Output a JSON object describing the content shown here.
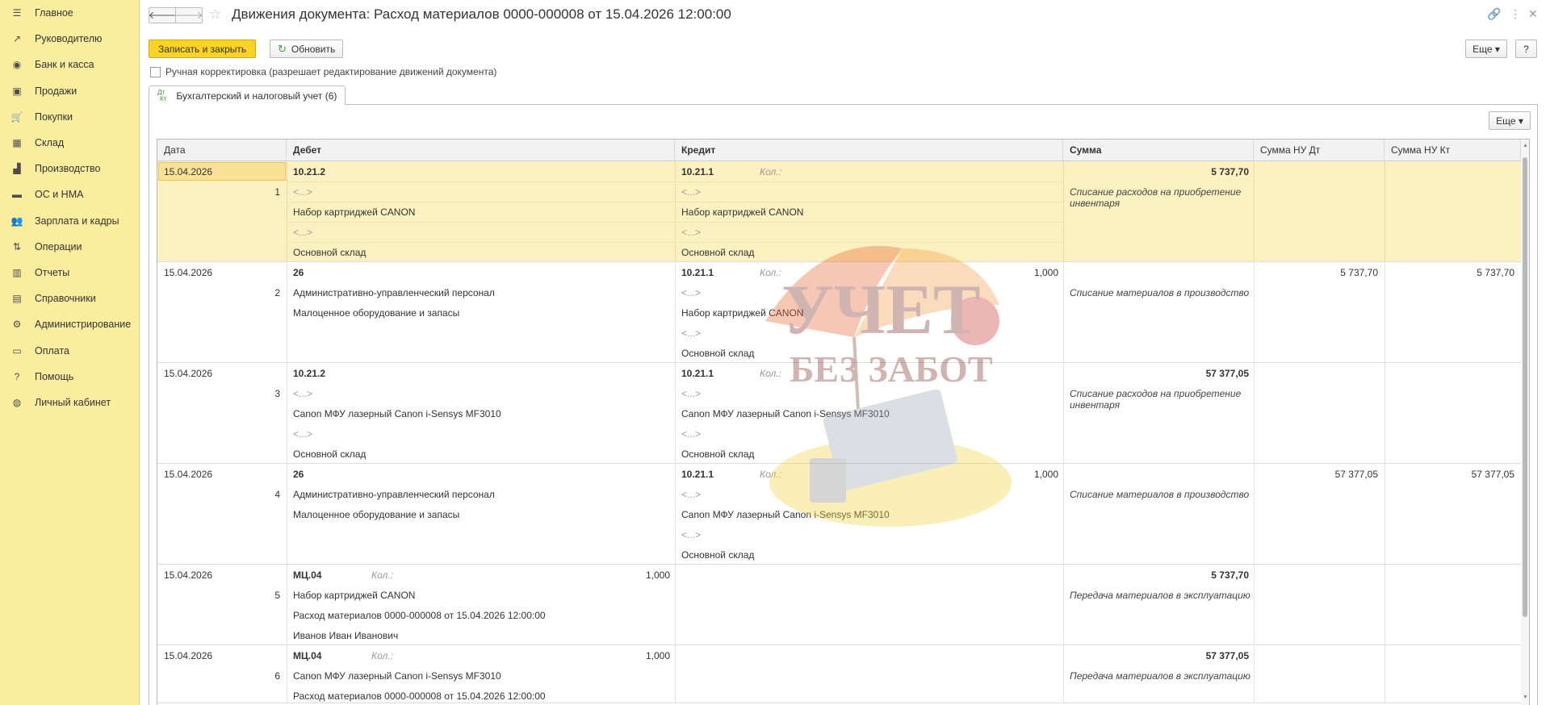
{
  "sidebar": {
    "items": [
      {
        "label": "Главное",
        "icon": "menu-icon"
      },
      {
        "label": "Руководителю",
        "icon": "trend-icon"
      },
      {
        "label": "Банк и касса",
        "icon": "coin-icon"
      },
      {
        "label": "Продажи",
        "icon": "bag-icon"
      },
      {
        "label": "Покупки",
        "icon": "cart-icon"
      },
      {
        "label": "Склад",
        "icon": "warehouse-icon"
      },
      {
        "label": "Производство",
        "icon": "factory-icon"
      },
      {
        "label": "ОС и НМА",
        "icon": "truck-icon"
      },
      {
        "label": "Зарплата и кадры",
        "icon": "people-icon"
      },
      {
        "label": "Операции",
        "icon": "dt-kt-icon"
      },
      {
        "label": "Отчеты",
        "icon": "bar-chart-icon"
      },
      {
        "label": "Справочники",
        "icon": "book-icon"
      },
      {
        "label": "Администрирование",
        "icon": "gear-icon"
      },
      {
        "label": "Оплата",
        "icon": "card-icon"
      },
      {
        "label": "Помощь",
        "icon": "question-icon"
      },
      {
        "label": "Личный кабинет",
        "icon": "user-circle-icon"
      }
    ]
  },
  "header": {
    "back": "🡐",
    "forward": "🡒",
    "star": "☆",
    "title": "Движения документа: Расход материалов 0000-000008 от 15.04.2026 12:00:00",
    "link": "🔗",
    "menu": "⋮",
    "close": "✕"
  },
  "toolbar": {
    "save_close": "Записать и закрыть",
    "refresh": "Обновить",
    "refresh_icon": "↻",
    "more": "Еще ▾",
    "help": "?"
  },
  "manual_edit": {
    "label": "Ручная корректировка (разрешает редактирование движений документа)"
  },
  "tabs": [
    {
      "label": "Бухгалтерский и налоговый учет (6)",
      "icon_top": "Дт",
      "icon_bottom": "Кт"
    }
  ],
  "grid": {
    "more": "Еще ▾",
    "columns": {
      "date": "Дата",
      "debit": "Дебет",
      "credit": "Кредит",
      "sum": "Сумма",
      "nu_dt": "Сумма НУ Дт",
      "nu_kt": "Сумма НУ Кт"
    },
    "qty_label": "Кол.:",
    "rows": [
      {
        "date": "15.04.2026",
        "n": "1",
        "debit": {
          "account": "10.21.2",
          "qty": "",
          "lines": [
            "<...>",
            "Набор картриджей CANON",
            "<...>",
            "Основной склад"
          ]
        },
        "credit": {
          "account": "10.21.1",
          "qty": "",
          "lines": [
            "<...>",
            "Набор картриджей CANON",
            "<...>",
            "Основной склад"
          ]
        },
        "sum": "5 737,70",
        "content": "Списание расходов на приобретение инвентаря",
        "nu_dt": "",
        "nu_kt": ""
      },
      {
        "date": "15.04.2026",
        "n": "2",
        "debit": {
          "account": "26",
          "qty": "",
          "lines": [
            "Административно-управленческий персонал",
            "Малоценное оборудование и запасы"
          ]
        },
        "credit": {
          "account": "10.21.1",
          "qty": "1,000",
          "lines": [
            "<...>",
            "Набор картриджей CANON",
            "<...>",
            "Основной склад"
          ]
        },
        "sum": "",
        "content": "Списание материалов в производство",
        "nu_dt": "5 737,70",
        "nu_kt": "5 737,70"
      },
      {
        "date": "15.04.2026",
        "n": "3",
        "debit": {
          "account": "10.21.2",
          "qty": "",
          "lines": [
            "<...>",
            "Canon МФУ лазерный Canon i-Sensys MF3010",
            "<...>",
            "Основной склад"
          ]
        },
        "credit": {
          "account": "10.21.1",
          "qty": "",
          "lines": [
            "<...>",
            "Canon МФУ лазерный Canon i-Sensys MF3010",
            "<...>",
            "Основной склад"
          ]
        },
        "sum": "57 377,05",
        "content": "Списание расходов на приобретение инвентаря",
        "nu_dt": "",
        "nu_kt": ""
      },
      {
        "date": "15.04.2026",
        "n": "4",
        "debit": {
          "account": "26",
          "qty": "",
          "lines": [
            "Административно-управленческий персонал",
            "Малоценное оборудование и запасы"
          ]
        },
        "credit": {
          "account": "10.21.1",
          "qty": "1,000",
          "lines": [
            "<...>",
            "Canon МФУ лазерный Canon i-Sensys MF3010",
            "<...>",
            "Основной склад"
          ]
        },
        "sum": "",
        "content": "Списание материалов в производство",
        "nu_dt": "57 377,05",
        "nu_kt": "57 377,05"
      },
      {
        "date": "15.04.2026",
        "n": "5",
        "debit": {
          "account": "МЦ.04",
          "qty": "1,000",
          "lines": [
            "Набор картриджей CANON",
            "Расход материалов 0000-000008 от 15.04.2026 12:00:00",
            "Иванов Иван Иванович"
          ]
        },
        "credit": {
          "account": "",
          "qty": "",
          "lines": []
        },
        "sum": "5 737,70",
        "content": "Передача материалов в эксплуатацию",
        "nu_dt": "",
        "nu_kt": ""
      },
      {
        "date": "15.04.2026",
        "n": "6",
        "debit": {
          "account": "МЦ.04",
          "qty": "1,000",
          "lines": [
            "Canon МФУ лазерный Canon i-Sensys MF3010",
            "Расход материалов 0000-000008 от 15.04.2026 12:00:00"
          ]
        },
        "credit": {
          "account": "",
          "qty": "",
          "lines": []
        },
        "sum": "57 377,05",
        "content": "Передача материалов в эксплуатацию",
        "nu_dt": "",
        "nu_kt": ""
      }
    ]
  },
  "watermark": {
    "line1": "УЧЕТ",
    "line2": "БЕЗ ЗАБОТ"
  },
  "colors": {
    "sidebar": "#fbed9e",
    "primary_button": "#fbd324",
    "selected_row": "#fcf1c0"
  }
}
